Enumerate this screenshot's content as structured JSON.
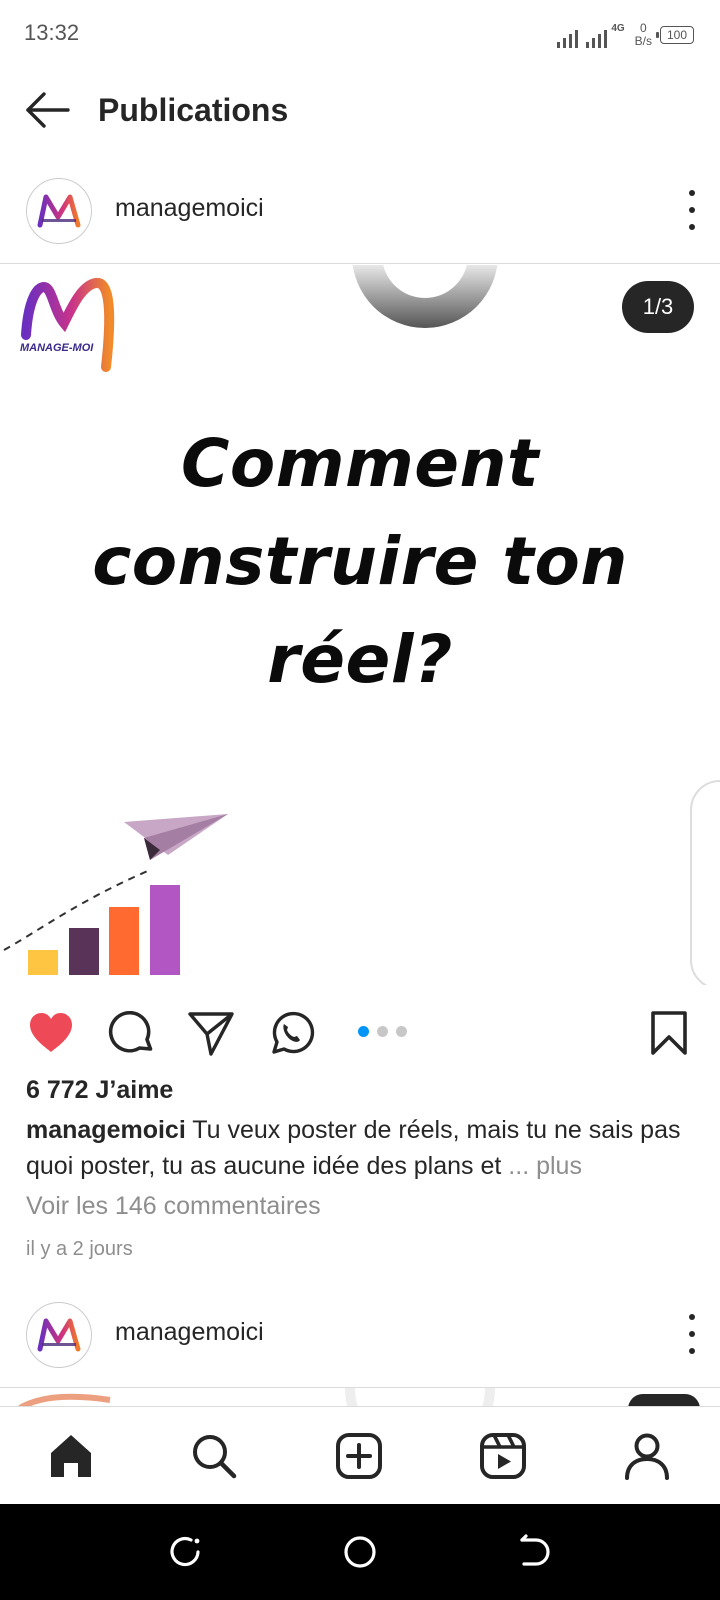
{
  "status_bar": {
    "time": "13:32",
    "network": "4G",
    "speed_value": "0",
    "speed_unit": "B/s",
    "battery": "100"
  },
  "header": {
    "title": "Publications"
  },
  "post": {
    "username": "managemoici",
    "logo_text": "MANAGE-MOI",
    "slide_counter": "1/3",
    "headline_lines": [
      "Comment",
      "construire ton",
      "réel?"
    ],
    "slide_count": 3,
    "active_slide": 1,
    "liked": true,
    "likes_text": "6 772 J’aime",
    "caption_username": "managemoici",
    "caption_text": "Tu veux poster de réels, mais tu ne sais pas quoi poster, tu as aucune idée des plans et",
    "caption_more": "... plus",
    "comments_link": "Voir les 146 commentaires",
    "timestamp": "il y a 2 jours",
    "chart_bar_colors": [
      "#fdc542",
      "#5a3358",
      "#ff6a30",
      "#b256c4"
    ]
  },
  "next_post": {
    "username": "managemoici"
  },
  "bottom_nav": {
    "items": [
      "home-icon",
      "search-icon",
      "add-post-icon",
      "reels-icon",
      "profile-icon"
    ],
    "active": "home-icon"
  },
  "colors": {
    "like_red": "#ed4956",
    "accent_blue": "#0095f6",
    "text": "#262626",
    "muted": "#8e8e8e"
  }
}
